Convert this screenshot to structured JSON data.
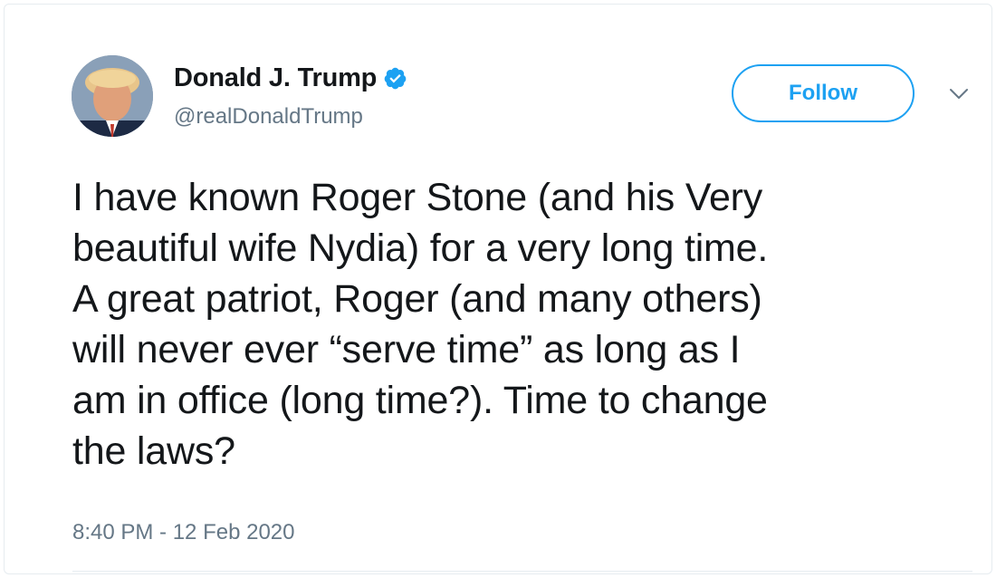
{
  "tweet": {
    "author": {
      "display_name": "Donald J. Trump",
      "handle": "@realDonaldTrump",
      "verified": true,
      "avatar_icon": "profile-photo-icon"
    },
    "follow_label": "Follow",
    "menu_icon": "chevron-down-icon",
    "text": "I have known Roger Stone (and his Very\nbeautiful wife Nydia) for a very long time.\nA great patriot, Roger (and many others)\nwill never ever “serve time” as long as I\nam in office (long time?). Time to change\nthe laws?",
    "timestamp": "8:40 PM - 12 Feb 2020"
  },
  "colors": {
    "accent": "#1da1f2",
    "text_primary": "#14171a",
    "text_secondary": "#657786",
    "border": "#e6ecf0"
  }
}
